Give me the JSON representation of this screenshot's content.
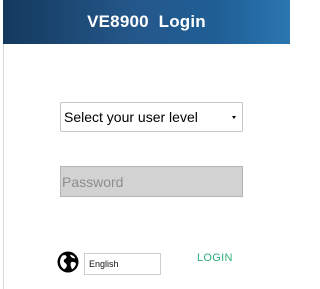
{
  "header": {
    "title": "VE8900  Login"
  },
  "login_form": {
    "user_level_select": {
      "value": "Select your user level"
    },
    "password": {
      "placeholder": "Password",
      "value": ""
    },
    "language_select": {
      "value": "English"
    },
    "login_label": "LOGIN"
  },
  "icons": {
    "language": "globe-icon",
    "dropdown": "caret-down-icon"
  },
  "colors": {
    "header_dark": "#14395d",
    "header_light": "#2c77b0",
    "login_link": "#2db27a",
    "password_bg": "#d2d2d2"
  }
}
